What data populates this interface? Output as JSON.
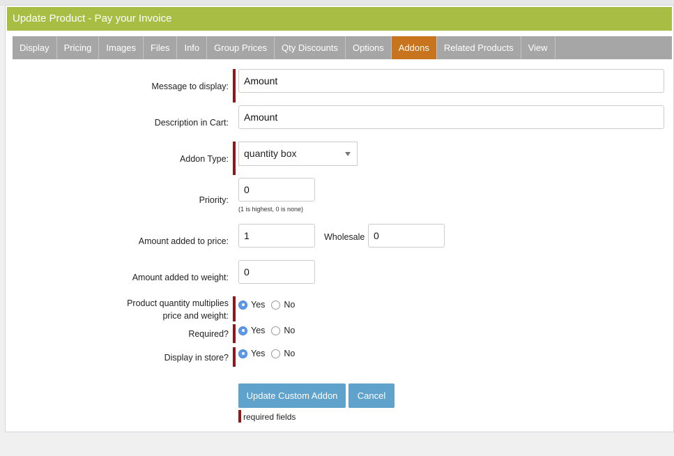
{
  "dialog": {
    "title": "Update Product - Pay your Invoice"
  },
  "tabs": [
    {
      "label": "Display",
      "active": false
    },
    {
      "label": "Pricing",
      "active": false
    },
    {
      "label": "Images",
      "active": false
    },
    {
      "label": "Files",
      "active": false
    },
    {
      "label": "Info",
      "active": false
    },
    {
      "label": "Group Prices",
      "active": false
    },
    {
      "label": "Qty Discounts",
      "active": false
    },
    {
      "label": "Options",
      "active": false
    },
    {
      "label": "Addons",
      "active": true
    },
    {
      "label": "Related Products",
      "active": false
    },
    {
      "label": "View",
      "active": false
    }
  ],
  "form": {
    "message": {
      "label": "Message to display:",
      "value": "Amount"
    },
    "description": {
      "label": "Description in Cart:",
      "value": "Amount"
    },
    "addon_type": {
      "label": "Addon Type:",
      "value": "quantity box"
    },
    "priority": {
      "label": "Priority:",
      "value": "0",
      "hint": "(1 is highest, 0 is none)"
    },
    "amount_price": {
      "label": "Amount added to price:",
      "value": "1",
      "wholesale_label": "Wholesale",
      "wholesale_value": "0"
    },
    "amount_weight": {
      "label": "Amount added to weight:",
      "value": "0"
    },
    "multiplies": {
      "label_line1": "Product quantity multiplies",
      "label_line2": "price and weight:",
      "yes": "Yes",
      "no": "No",
      "selected": "Yes"
    },
    "required": {
      "label": "Required?",
      "yes": "Yes",
      "no": "No",
      "selected": "Yes"
    },
    "display_store": {
      "label": "Display in store?",
      "yes": "Yes",
      "no": "No",
      "selected": "Yes"
    }
  },
  "buttons": {
    "update": "Update Custom Addon",
    "cancel": "Cancel"
  },
  "required_note": "required fields",
  "colors": {
    "titlebar": "#a8bd44",
    "tab_active": "#c8731d",
    "tab_bg": "#a6a6a6",
    "button": "#5fa2cb",
    "required_marker": "#8b1a1a"
  }
}
